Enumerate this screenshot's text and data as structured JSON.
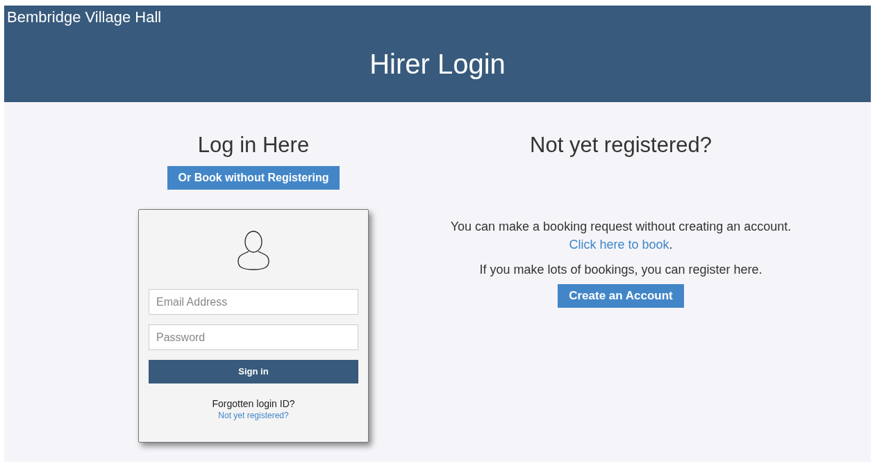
{
  "header": {
    "site_name": "Bembridge Village Hall",
    "title": "Hirer Login"
  },
  "login": {
    "heading": "Log in Here",
    "book_button": "Or Book without Registering",
    "email_placeholder": "Email Address",
    "password_placeholder": "Password",
    "sign_in": "Sign in",
    "forgotten": "Forgotten login ID?",
    "register_link": "Not yet registered?"
  },
  "register": {
    "heading": "Not yet registered?",
    "text_1": "You can make a booking request without creating an account.",
    "book_link": "Click here to book",
    "link_suffix": ".",
    "text_2": "If you make lots of bookings, you can register here.",
    "create_button": "Create an Account"
  }
}
